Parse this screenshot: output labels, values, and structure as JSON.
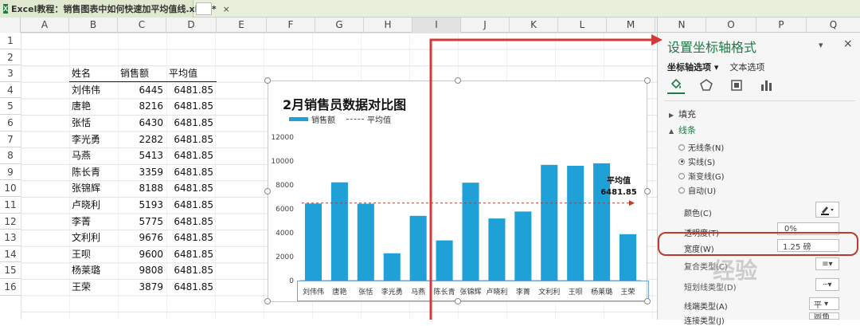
{
  "titlebar": {
    "file_name": "Excel教程：销售图表中如何快速加平均值线.xlsx *",
    "close": "×"
  },
  "columns": [
    "A",
    "B",
    "C",
    "D",
    "E",
    "F",
    "G",
    "H",
    "I",
    "J",
    "K",
    "L",
    "M"
  ],
  "pane_columns": [
    "N",
    "O",
    "P",
    "Q"
  ],
  "rows": [
    "1",
    "2",
    "3",
    "4",
    "5",
    "6",
    "7",
    "8",
    "9",
    "10",
    "11",
    "12",
    "13",
    "14",
    "15",
    "16"
  ],
  "table": {
    "headers": [
      "姓名",
      "销售额",
      "平均值"
    ],
    "rows": [
      [
        "刘伟伟",
        "6445",
        "6481.85"
      ],
      [
        "唐艳",
        "8216",
        "6481.85"
      ],
      [
        "张恬",
        "6430",
        "6481.85"
      ],
      [
        "李光勇",
        "2282",
        "6481.85"
      ],
      [
        "马燕",
        "5413",
        "6481.85"
      ],
      [
        "陈长青",
        "3359",
        "6481.85"
      ],
      [
        "张锦辉",
        "8188",
        "6481.85"
      ],
      [
        "卢晓利",
        "5193",
        "6481.85"
      ],
      [
        "李菁",
        "5775",
        "6481.85"
      ],
      [
        "文利利",
        "9676",
        "6481.85"
      ],
      [
        "王呗",
        "9600",
        "6481.85"
      ],
      [
        "杨莱璐",
        "9808",
        "6481.85"
      ],
      [
        "王荣",
        "3879",
        "6481.85"
      ]
    ]
  },
  "chart_data": {
    "type": "bar",
    "title": "2月销售员数据对比图",
    "categories": [
      "刘伟伟",
      "唐艳",
      "张恬",
      "李光勇",
      "马燕",
      "陈长青",
      "张锦辉",
      "卢晓利",
      "李菁",
      "文利利",
      "王呗",
      "杨莱璐",
      "王荣"
    ],
    "series": [
      {
        "name": "销售额",
        "type": "bar",
        "values": [
          6445,
          8216,
          6430,
          2282,
          5413,
          3359,
          8188,
          5193,
          5775,
          9676,
          9600,
          9808,
          3879
        ],
        "color": "#1fa1d8"
      },
      {
        "name": "平均值",
        "type": "line",
        "style": "dashed",
        "values": [
          6481.85,
          6481.85,
          6481.85,
          6481.85,
          6481.85,
          6481.85,
          6481.85,
          6481.85,
          6481.85,
          6481.85,
          6481.85,
          6481.85,
          6481.85
        ],
        "color": "#c0392b"
      }
    ],
    "yticks": [
      "0",
      "2000",
      "4000",
      "6000",
      "8000",
      "10000",
      "12000"
    ],
    "ylim": [
      0,
      12000
    ],
    "annotation": {
      "label": "平均值",
      "value": "6481.85"
    },
    "legend": "top-left",
    "grid": false
  },
  "pane": {
    "title": "设置坐标轴格式",
    "ctrl_icon": "▾",
    "close": "×",
    "tabs": {
      "axis_options": "坐标轴选项 ▾",
      "text_options": "文本选项"
    },
    "icons": [
      "fill-bucket-icon",
      "pentagon-icon",
      "size-icon",
      "bar-chart-icon"
    ],
    "sections": {
      "fill": "填充",
      "line": "线条"
    },
    "line_options": [
      "无线条(N)",
      "实线(S)",
      "渐变线(G)",
      "自动(U)"
    ],
    "props": {
      "color": "颜色(C)",
      "transparency": "透明度(T)",
      "transparency_value": "0%",
      "width": "宽度(W)",
      "width_value": "1.25 磅",
      "compound": "复合类型(C)",
      "dash": "短划线类型(D)",
      "cap": "线端类型(A)",
      "cap_value": "平",
      "join": "连接类型(J)",
      "join_value": "圆角"
    }
  },
  "watermark": "经验"
}
